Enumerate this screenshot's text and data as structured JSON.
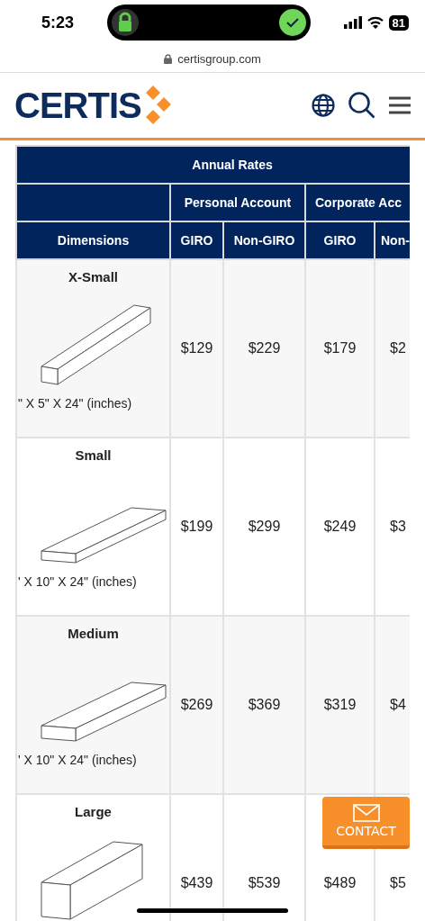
{
  "status_bar": {
    "time": "5:23",
    "battery": "81"
  },
  "address_bar": {
    "url": "certisgroup.com"
  },
  "header": {
    "logo": "CERTIS"
  },
  "table": {
    "title": "Annual Rates",
    "groups": [
      "Personal Account",
      "Corporate Acc"
    ],
    "columns": [
      "Dimensions",
      "GIRO",
      "Non-GIRO",
      "GIRO",
      "Non-"
    ],
    "rows": [
      {
        "size": "X-Small",
        "kind": "bar",
        "dimensions": "\" X 5\" X 24\" (inches)",
        "values": [
          "$129",
          "$229",
          "$179",
          "$2"
        ]
      },
      {
        "size": "Small",
        "kind": "flat",
        "dimensions": "' X 10\" X 24\" (inches)",
        "values": [
          "$199",
          "$299",
          "$249",
          "$3"
        ]
      },
      {
        "size": "Medium",
        "kind": "slab",
        "dimensions": "' X 10\" X 24\" (inches)",
        "values": [
          "$269",
          "$369",
          "$319",
          "$4"
        ]
      },
      {
        "size": "Large",
        "kind": "block",
        "values": [
          "$439",
          "$539",
          "$489",
          "$5"
        ]
      }
    ]
  },
  "contact_button": {
    "label": "CONTACT"
  }
}
